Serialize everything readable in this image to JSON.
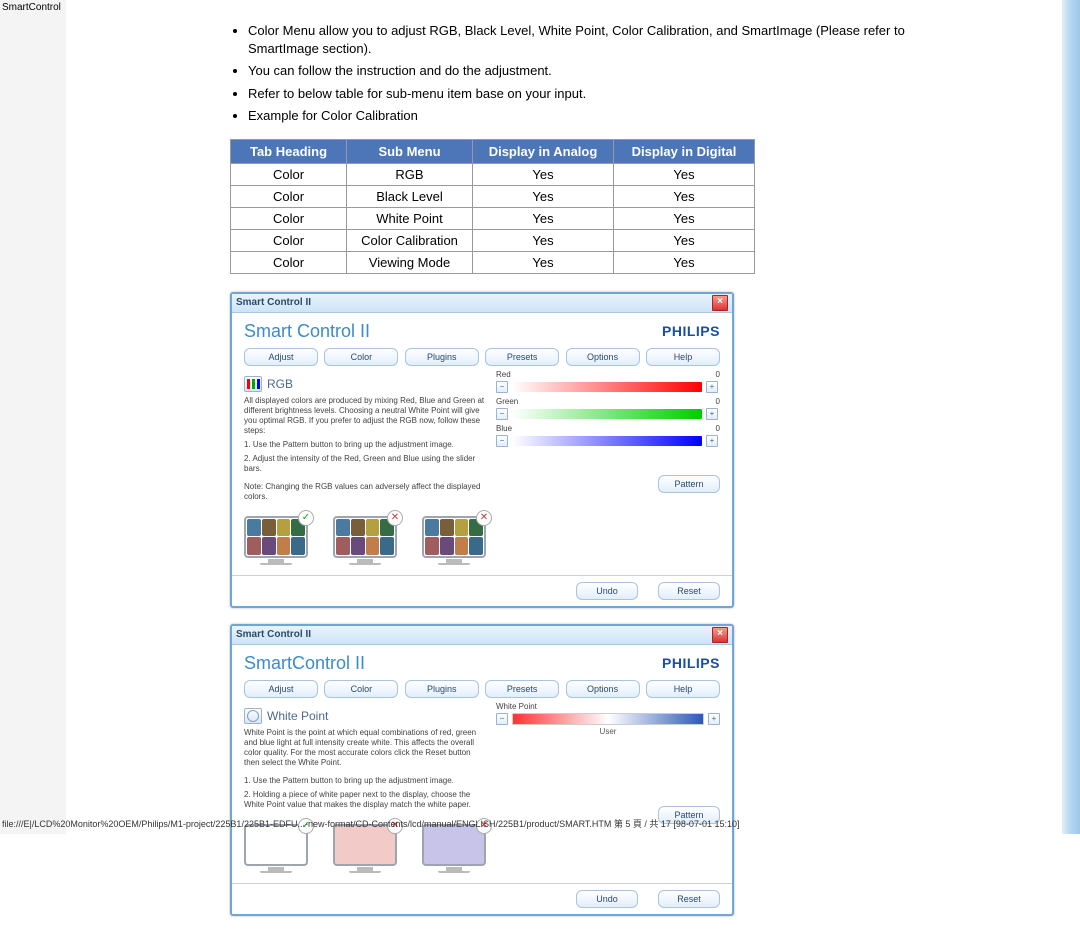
{
  "page": {
    "header_title": "SmartControl",
    "footer_path": "file:///E|/LCD%20Monitor%20OEM/Philips/M1-project/225B1/225B1-EDFU...-new-format/CD-Contents/lcd/manual/ENGLISH/225B1/product/SMART.HTM 第 5 頁 / 共 17 [98-07-01 15:10]"
  },
  "bullets": [
    "Color Menu allow you to adjust RGB, Black Level, White Point, Color Calibration, and SmartImage (Please refer to SmartImage section).",
    "You can follow the instruction and do the adjustment.",
    "Refer to below table for sub-menu item base on your input.",
    "Example for Color Calibration"
  ],
  "table": {
    "headers": [
      "Tab Heading",
      "Sub Menu",
      "Display in Analog",
      "Display in Digital"
    ],
    "rows": [
      [
        "Color",
        "RGB",
        "Yes",
        "Yes"
      ],
      [
        "Color",
        "Black Level",
        "Yes",
        "Yes"
      ],
      [
        "Color",
        "White Point",
        "Yes",
        "Yes"
      ],
      [
        "Color",
        "Color Calibration",
        "Yes",
        "Yes"
      ],
      [
        "Color",
        "Viewing Mode",
        "Yes",
        "Yes"
      ]
    ]
  },
  "dlg1": {
    "titlebar": "Smart Control II",
    "app_title": "Smart Control II",
    "brand": "PHILIPS",
    "tabs": [
      "Adjust",
      "Color",
      "Plugins",
      "Presets",
      "Options",
      "Help"
    ],
    "section_title": "RGB",
    "para1": "All displayed colors are produced by mixing Red, Blue and Green at different brightness levels. Choosing a neutral White Point will give you optimal RGB. If you prefer to adjust the RGB now, follow these steps:",
    "step1": "1. Use the Pattern button to bring up the adjustment image.",
    "step2": "2. Adjust the intensity of the Red, Green and Blue using the slider bars.",
    "note": "Note: Changing the RGB values can adversely affect the displayed colors.",
    "sliders": [
      {
        "label": "Red",
        "value": "0",
        "class": "bar-red"
      },
      {
        "label": "Green",
        "value": "0",
        "class": "bar-green"
      },
      {
        "label": "Blue",
        "value": "0",
        "class": "bar-blue"
      }
    ],
    "pattern_btn": "Pattern",
    "undo_btn": "Undo",
    "reset_btn": "Reset"
  },
  "dlg2": {
    "titlebar": "Smart Control II",
    "app_title": "SmartControl II",
    "brand": "PHILIPS",
    "tabs": [
      "Adjust",
      "Color",
      "Plugins",
      "Presets",
      "Options",
      "Help"
    ],
    "section_title": "White Point",
    "para1": "White Point is the point at which equal combinations of red, green and blue light at full intensity create white. This affects the overall color quality. For the most accurate colors click the Reset button then select the White Point.",
    "step1": "1. Use the Pattern button to bring up the adjustment image.",
    "step2": "2. Holding a piece of white paper next to the display, choose the White Point value that makes the display match the white paper.",
    "slider_label": "White Point",
    "user_label": "User",
    "pattern_btn": "Pattern",
    "undo_btn": "Undo",
    "reset_btn": "Reset"
  }
}
